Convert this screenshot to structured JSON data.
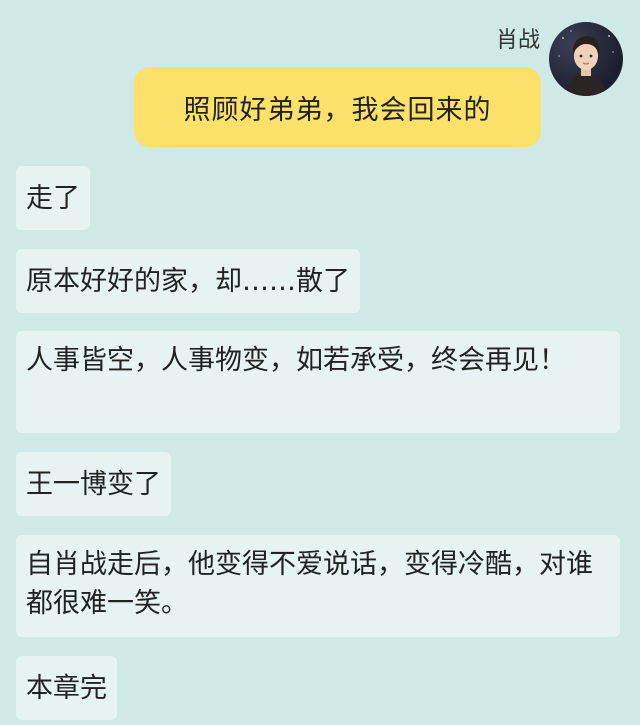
{
  "message": {
    "sender_name": "肖战",
    "text": "照顾好弟弟，我会回来的",
    "bubble_color": "#fbe06a"
  },
  "narration": [
    {
      "text": "走了"
    },
    {
      "text": "原本好好的家，却……散了"
    },
    {
      "text": "人事皆空，人事物变，如若承受，终会再见！"
    },
    {
      "text": "王一博变了"
    },
    {
      "text": "自肖战走后，他变得不爱说话，变得冷酷，对谁都很难一笑。"
    },
    {
      "text": "本章完"
    }
  ],
  "colors": {
    "background": "#cfe9e6",
    "narration_bubble": "#e6f3f2"
  }
}
